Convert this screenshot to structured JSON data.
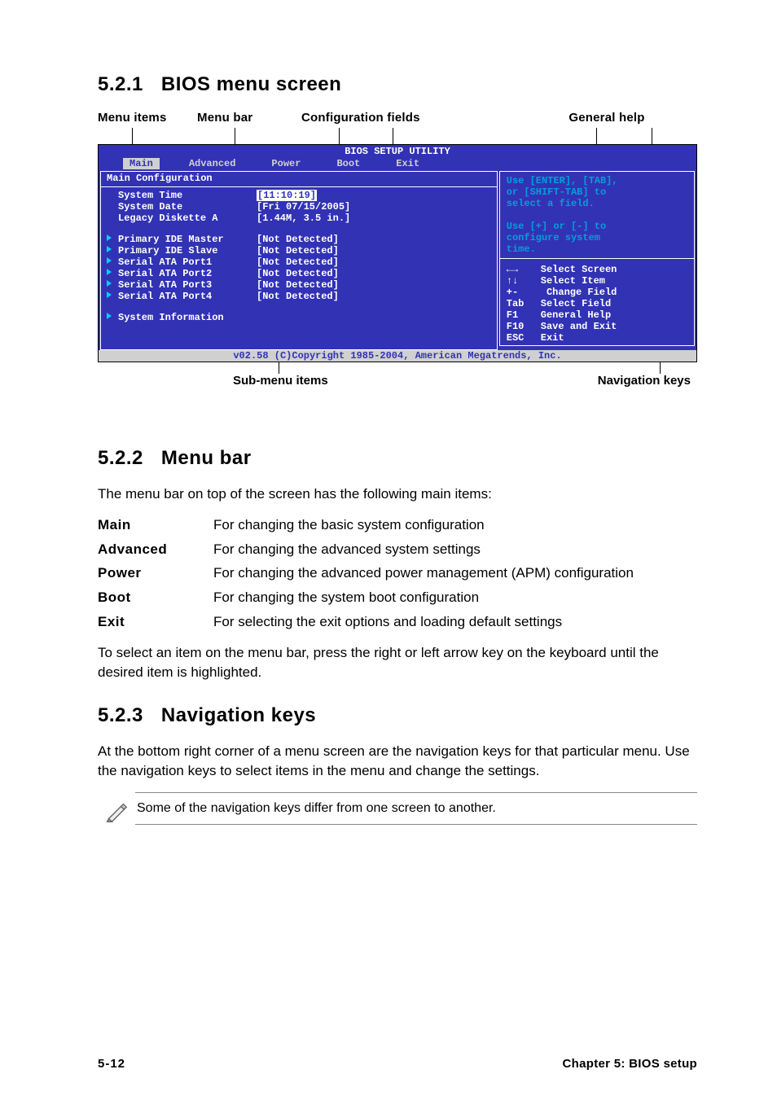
{
  "section_521": {
    "num": "5.2.1",
    "title": "BIOS menu screen"
  },
  "figure_labels": {
    "menu_items": "Menu items",
    "menu_bar": "Menu bar",
    "config_fields": "Configuration fields",
    "general_help": "General help",
    "sub_menu_items": "Sub-menu items",
    "nav_keys": "Navigation keys"
  },
  "bios": {
    "title": "BIOS SETUP UTILITY",
    "tabs": [
      "Main",
      "Advanced",
      "Power",
      "Boot",
      "Exit"
    ],
    "main_panel_title": "Main Configuration",
    "items": [
      {
        "marker": "",
        "label": "System Time",
        "value": "[11:10:19]",
        "selected": true,
        "cyan": false
      },
      {
        "marker": "",
        "label": "System Date",
        "value": "[Fri 07/15/2005]",
        "selected": false,
        "cyan": false
      },
      {
        "marker": "",
        "label": "Legacy Diskette A",
        "value": "[1.44M, 3.5 in.]",
        "selected": false,
        "cyan": false
      },
      {
        "marker": "spacer"
      },
      {
        "marker": "▶",
        "label": "Primary IDE Master",
        "value": "[Not Detected]",
        "cyan": true
      },
      {
        "marker": "▶",
        "label": "Primary IDE Slave",
        "value": "[Not Detected]",
        "cyan": true
      },
      {
        "marker": "▶",
        "label": "Serial ATA Port1",
        "value": "[Not Detected]",
        "cyan": true
      },
      {
        "marker": "▶",
        "label": "Serial ATA Port2",
        "value": "[Not Detected]",
        "cyan": true
      },
      {
        "marker": "▶",
        "label": "Serial ATA Port3",
        "value": "[Not Detected]",
        "cyan": true
      },
      {
        "marker": "▶",
        "label": "Serial ATA Port4",
        "value": "[Not Detected]",
        "cyan": true
      },
      {
        "marker": "spacer"
      },
      {
        "marker": "▶",
        "label": "System Information",
        "value": "",
        "cyan": true
      }
    ],
    "help_top_lines": [
      "Use [ENTER], [TAB],",
      "or [SHIFT-TAB] to",
      "select a field.",
      "",
      "Use  [+] or [-] to",
      "configure system",
      "time."
    ],
    "help_keys": [
      {
        "key": "←→",
        "txt": "Select Screen"
      },
      {
        "key": "↑↓",
        "txt": "Select Item"
      },
      {
        "key": "+-",
        "txt": " Change Field"
      },
      {
        "key": "Tab",
        "txt": "Select Field"
      },
      {
        "key": "F1",
        "txt": "General Help"
      },
      {
        "key": "F10",
        "txt": "Save and Exit"
      },
      {
        "key": "ESC",
        "txt": "Exit"
      }
    ],
    "footer": "v02.58 (C)Copyright 1985-2004, American Megatrends, Inc."
  },
  "section_522": {
    "num": "5.2.2",
    "title": "Menu bar",
    "intro": "The menu bar on top of the screen has the following main items:",
    "defs": [
      {
        "term": "Main",
        "desc": "For changing the basic system configuration"
      },
      {
        "term": "Advanced",
        "desc": "For changing the advanced system settings"
      },
      {
        "term": "Power",
        "desc": "For changing the advanced power management (APM) configuration"
      },
      {
        "term": "Boot",
        "desc": "For changing the system boot configuration"
      },
      {
        "term": "Exit",
        "desc": "For selecting the exit options and loading default settings"
      }
    ],
    "outro": "To select an item on the menu bar, press the right or left arrow key on the keyboard until the desired item is highlighted."
  },
  "section_523": {
    "num": "5.2.3",
    "title": "Navigation keys",
    "para": "At the bottom right corner of a menu screen are the navigation keys for that particular menu. Use the navigation keys to select items in the menu and change the settings.",
    "note": "Some of the navigation keys differ from one screen to another."
  },
  "page_footer": {
    "left": "5-12",
    "right": "Chapter 5: BIOS setup"
  }
}
